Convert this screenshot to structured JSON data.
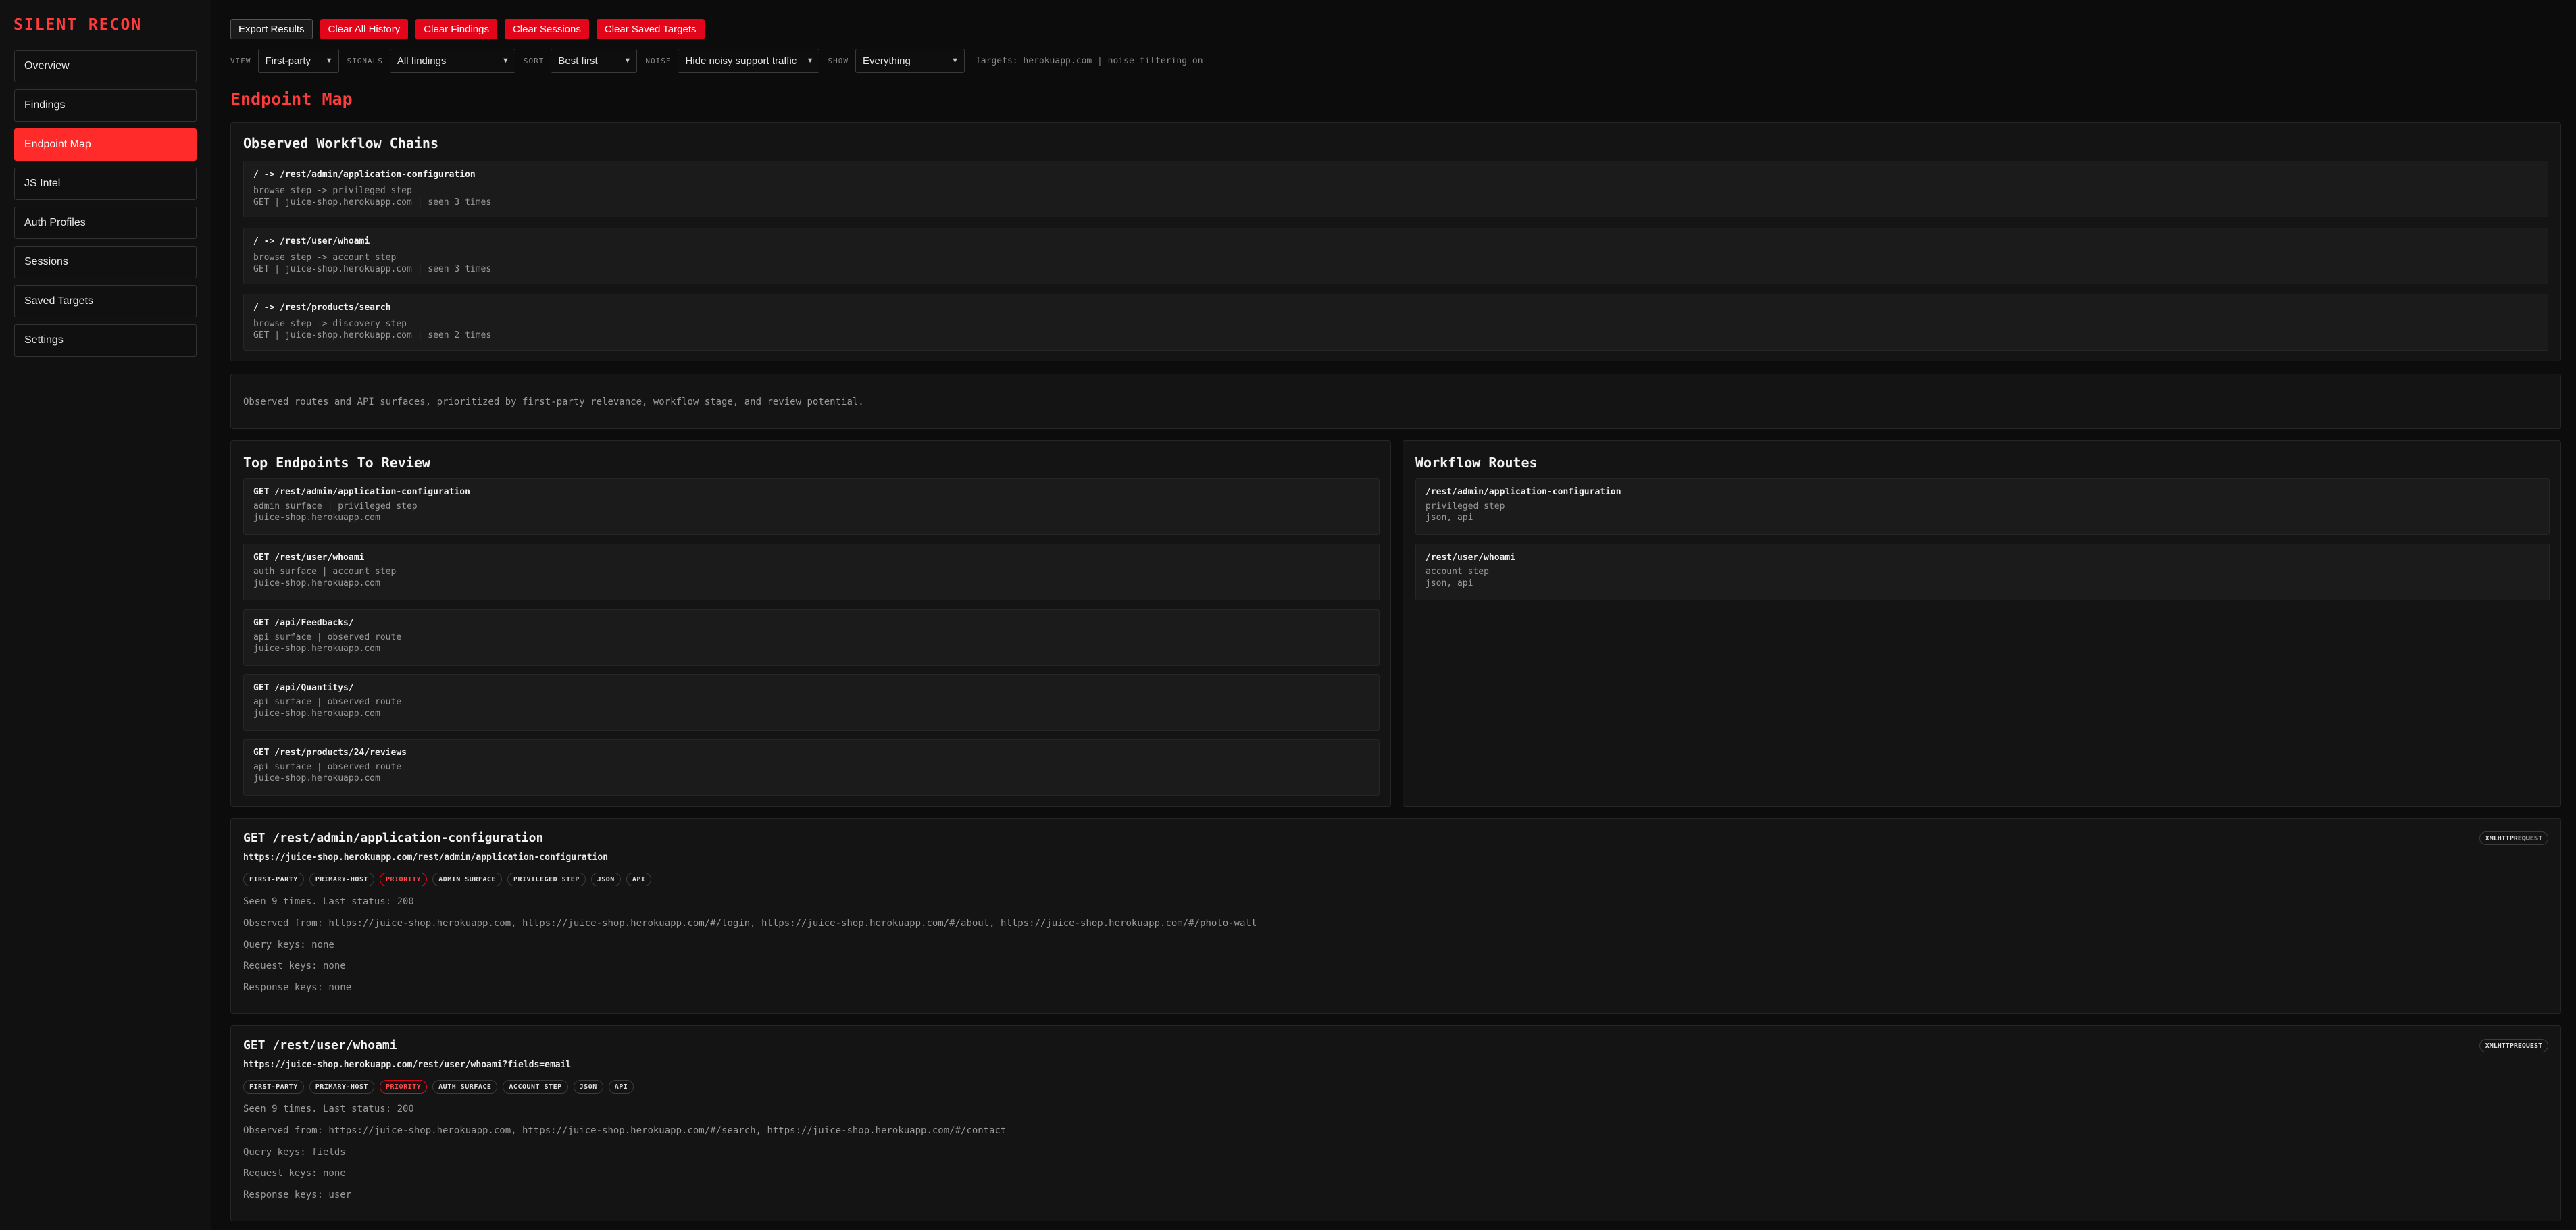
{
  "app": {
    "brand": "SILENT RECON"
  },
  "sidebar": {
    "items": [
      {
        "label": "Overview"
      },
      {
        "label": "Findings"
      },
      {
        "label": "Endpoint Map"
      },
      {
        "label": "JS Intel"
      },
      {
        "label": "Auth Profiles"
      },
      {
        "label": "Sessions"
      },
      {
        "label": "Saved Targets"
      },
      {
        "label": "Settings"
      }
    ],
    "active": "Endpoint Map"
  },
  "toolbar": {
    "export": "Export Results",
    "clear_history": "Clear All History",
    "clear_findings": "Clear Findings",
    "clear_sessions": "Clear Sessions",
    "clear_targets": "Clear Saved Targets"
  },
  "filters": {
    "view_label": "VIEW",
    "view_value": "First-party",
    "signals_label": "SIGNALS",
    "signals_value": "All findings",
    "sort_label": "SORT",
    "sort_value": "Best first",
    "noise_label": "NOISE",
    "noise_value": "Hide noisy support traffic",
    "show_label": "SHOW",
    "show_value": "Everything",
    "status": "Targets: herokuapp.com | noise filtering on"
  },
  "page": {
    "title": "Endpoint Map"
  },
  "workflow_chains": {
    "title": "Observed Workflow Chains",
    "items": [
      {
        "title": "/ -> /rest/admin/application-configuration",
        "line1": "browse step -> privileged step",
        "line2": "GET | juice-shop.herokuapp.com | seen 3 times"
      },
      {
        "title": "/ -> /rest/user/whoami",
        "line1": "browse step -> account step",
        "line2": "GET | juice-shop.herokuapp.com | seen 3 times"
      },
      {
        "title": "/ -> /rest/products/search",
        "line1": "browse step -> discovery step",
        "line2": "GET | juice-shop.herokuapp.com | seen 2 times"
      }
    ]
  },
  "description": "Observed routes and API surfaces, prioritized by first-party relevance, workflow stage, and review potential.",
  "top_endpoints": {
    "title": "Top Endpoints To Review",
    "items": [
      {
        "title": "GET /rest/admin/application-configuration",
        "line1": "admin surface | privileged step",
        "line2": "juice-shop.herokuapp.com"
      },
      {
        "title": "GET /rest/user/whoami",
        "line1": "auth surface | account step",
        "line2": "juice-shop.herokuapp.com"
      },
      {
        "title": "GET /api/Feedbacks/",
        "line1": "api surface | observed route",
        "line2": "juice-shop.herokuapp.com"
      },
      {
        "title": "GET /api/Quantitys/",
        "line1": "api surface | observed route",
        "line2": "juice-shop.herokuapp.com"
      },
      {
        "title": "GET /rest/products/24/reviews",
        "line1": "api surface | observed route",
        "line2": "juice-shop.herokuapp.com"
      }
    ]
  },
  "workflow_routes": {
    "title": "Workflow Routes",
    "items": [
      {
        "title": "/rest/admin/application-configuration",
        "line1": "privileged step",
        "line2": "json, api"
      },
      {
        "title": "/rest/user/whoami",
        "line1": "account step",
        "line2": "json, api"
      }
    ]
  },
  "details": [
    {
      "title": "GET /rest/admin/application-configuration",
      "url": "https://juice-shop.herokuapp.com/rest/admin/application-configuration",
      "badge": "XMLHTTPREQUEST",
      "tags": [
        "FIRST-PARTY",
        "PRIMARY-HOST",
        "PRIORITY",
        "ADMIN SURFACE",
        "PRIVILEGED STEP",
        "JSON",
        "API"
      ],
      "seen": "Seen 9 times. Last status: 200",
      "observed": "Observed from: https://juice-shop.herokuapp.com, https://juice-shop.herokuapp.com/#/login, https://juice-shop.herokuapp.com/#/about, https://juice-shop.herokuapp.com/#/photo-wall",
      "query": "Query keys: none",
      "request": "Request keys: none",
      "response": "Response keys: none"
    },
    {
      "title": "GET /rest/user/whoami",
      "url": "https://juice-shop.herokuapp.com/rest/user/whoami?fields=email",
      "badge": "XMLHTTPREQUEST",
      "tags": [
        "FIRST-PARTY",
        "PRIMARY-HOST",
        "PRIORITY",
        "AUTH SURFACE",
        "ACCOUNT STEP",
        "JSON",
        "API"
      ],
      "seen": "Seen 9 times. Last status: 200",
      "observed": "Observed from: https://juice-shop.herokuapp.com, https://juice-shop.herokuapp.com/#/search, https://juice-shop.herokuapp.com/#/contact",
      "query": "Query keys: fields",
      "request": "Request keys: none",
      "response": "Response keys: user"
    }
  ]
}
